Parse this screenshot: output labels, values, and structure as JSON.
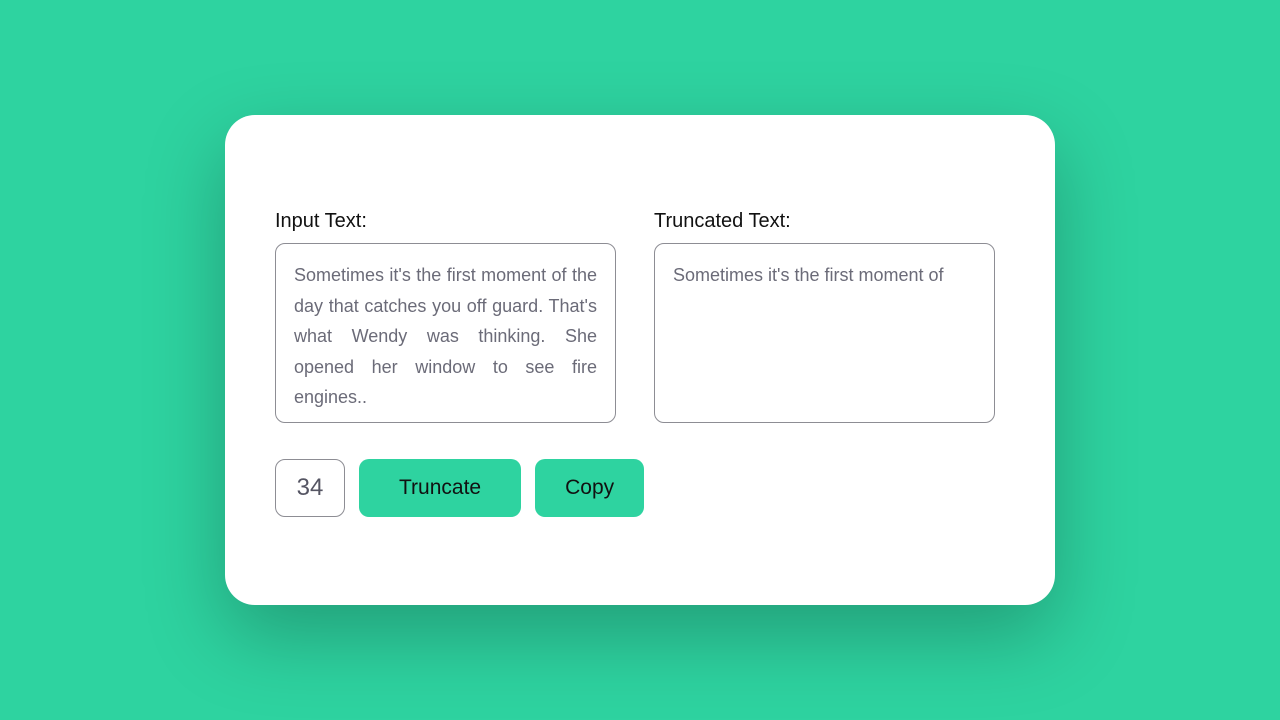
{
  "input": {
    "label": "Input Text:",
    "value": "Sometimes it's the first moment of the day that catches you off guard. That's what Wendy was thinking. She opened her window to see fire engines.."
  },
  "output": {
    "label": "Truncated Text:",
    "value": "Sometimes it's the first moment of"
  },
  "controls": {
    "length_value": "34",
    "truncate_label": "Truncate",
    "copy_label": "Copy"
  }
}
